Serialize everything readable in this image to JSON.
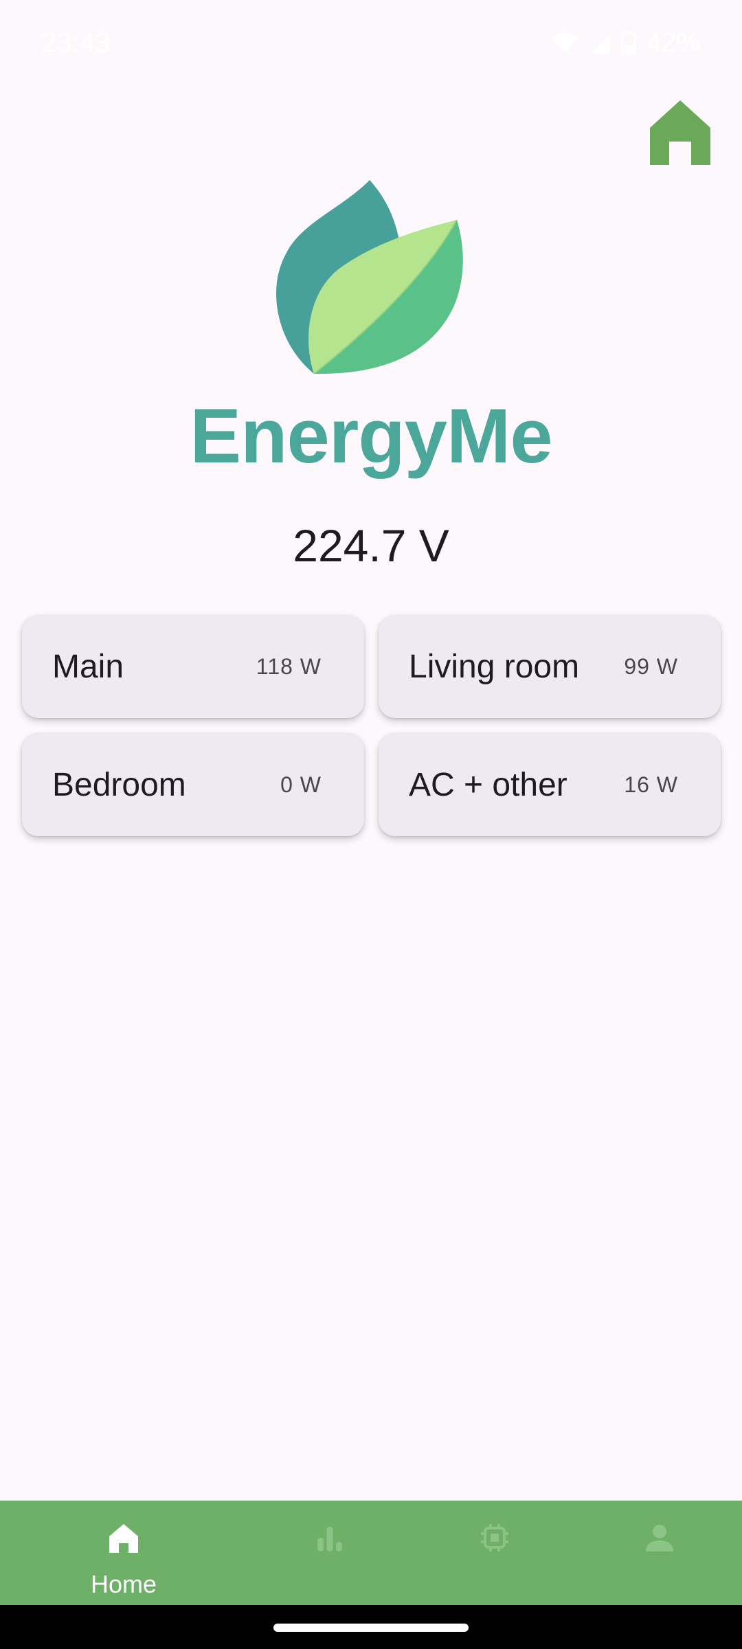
{
  "status_bar": {
    "time": "23:43",
    "battery": "42%"
  },
  "app": {
    "name": "EnergyMe"
  },
  "voltage": "224.7 V",
  "channels": [
    {
      "name": "Main",
      "power": "118 W"
    },
    {
      "name": "Living room",
      "power": "99 W"
    },
    {
      "name": "Bedroom",
      "power": "0 W"
    },
    {
      "name": "AC + other",
      "power": "16 W"
    }
  ],
  "bottom_nav": {
    "items": [
      {
        "label": "Home",
        "icon": "home-icon",
        "active": true
      },
      {
        "label": "",
        "icon": "bar-chart-icon",
        "active": false
      },
      {
        "label": "",
        "icon": "chip-icon",
        "active": false
      },
      {
        "label": "",
        "icon": "person-icon",
        "active": false
      }
    ]
  },
  "colors": {
    "brand_teal": "#4aa79a",
    "nav_green": "#6fb068",
    "card_bg": "#efeaf2",
    "page_bg": "#fcf8fc"
  }
}
